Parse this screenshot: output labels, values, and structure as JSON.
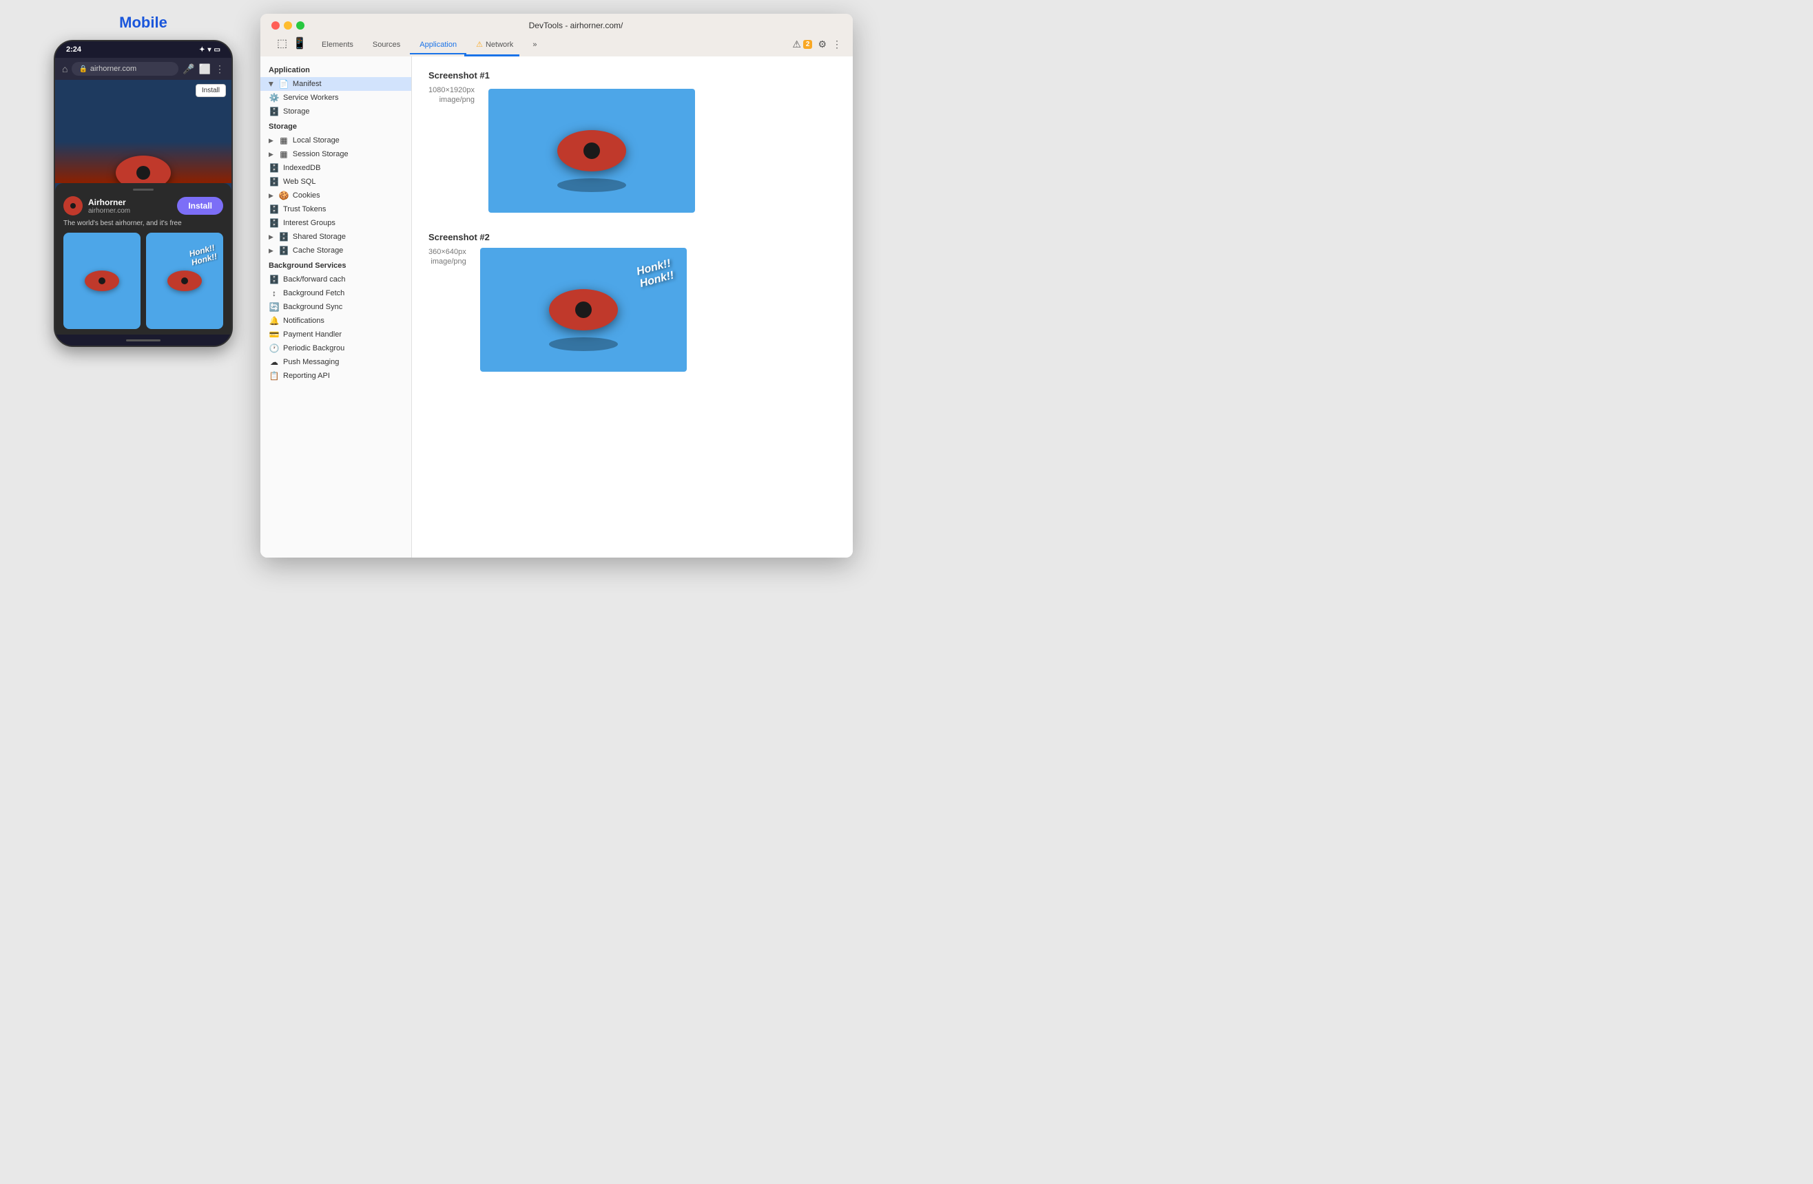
{
  "mobile": {
    "label": "Mobile",
    "status_bar": {
      "time": "2:24"
    },
    "address_bar": {
      "url": "airhorner.com"
    },
    "install_banner": "Install",
    "app_name": "Airhorner",
    "app_url": "airhorner.com",
    "install_button": "Install",
    "description": "The world's best airhorner, and it's free",
    "screenshot1_honk": "",
    "screenshot2_honk1": "Honk!!",
    "screenshot2_honk2": "Honk!!"
  },
  "devtools": {
    "title": "DevTools - airhorner.com/",
    "tabs": [
      {
        "label": "Elements",
        "active": false
      },
      {
        "label": "Sources",
        "active": false
      },
      {
        "label": "Application",
        "active": true
      },
      {
        "label": "⚠ Network",
        "active": false
      }
    ],
    "warning_count": "2",
    "sidebar": {
      "sections": [
        {
          "label": "Application",
          "items": [
            {
              "label": "Manifest",
              "icon": "📄",
              "arrow": true,
              "selected": true
            },
            {
              "label": "Service Workers",
              "icon": "⚙️",
              "arrow": false
            },
            {
              "label": "Storage",
              "icon": "🗄️",
              "arrow": false
            }
          ]
        },
        {
          "label": "Storage",
          "items": [
            {
              "label": "Local Storage",
              "icon": "▦",
              "arrow": true
            },
            {
              "label": "Session Storage",
              "icon": "▦",
              "arrow": true
            },
            {
              "label": "IndexedDB",
              "icon": "🗄️",
              "arrow": false
            },
            {
              "label": "Web SQL",
              "icon": "🗄️",
              "arrow": false
            },
            {
              "label": "Cookies",
              "icon": "🍪",
              "arrow": true
            },
            {
              "label": "Trust Tokens",
              "icon": "🗄️",
              "arrow": false
            },
            {
              "label": "Interest Groups",
              "icon": "🗄️",
              "arrow": false
            },
            {
              "label": "Shared Storage",
              "icon": "🗄️",
              "arrow": true
            },
            {
              "label": "Cache Storage",
              "icon": "🗄️",
              "arrow": true
            }
          ]
        },
        {
          "label": "Background Services",
          "items": [
            {
              "label": "Back/forward cach",
              "icon": "🗄️",
              "arrow": false
            },
            {
              "label": "Background Fetch",
              "icon": "↕",
              "arrow": false
            },
            {
              "label": "Background Sync",
              "icon": "🔄",
              "arrow": false
            },
            {
              "label": "Notifications",
              "icon": "🔔",
              "arrow": false
            },
            {
              "label": "Payment Handler",
              "icon": "💳",
              "arrow": false
            },
            {
              "label": "Periodic Backgrou",
              "icon": "🕐",
              "arrow": false
            },
            {
              "label": "Push Messaging",
              "icon": "☁",
              "arrow": false
            },
            {
              "label": "Reporting API",
              "icon": "📋",
              "arrow": false
            }
          ]
        }
      ]
    },
    "main": {
      "screenshot1": {
        "title": "Screenshot #1",
        "dimensions": "1080×1920px",
        "type": "image/png"
      },
      "screenshot2": {
        "title": "Screenshot #2",
        "dimensions": "360×640px",
        "type": "image/png",
        "honk1": "Honk!!",
        "honk2": "Honk!!"
      }
    }
  }
}
